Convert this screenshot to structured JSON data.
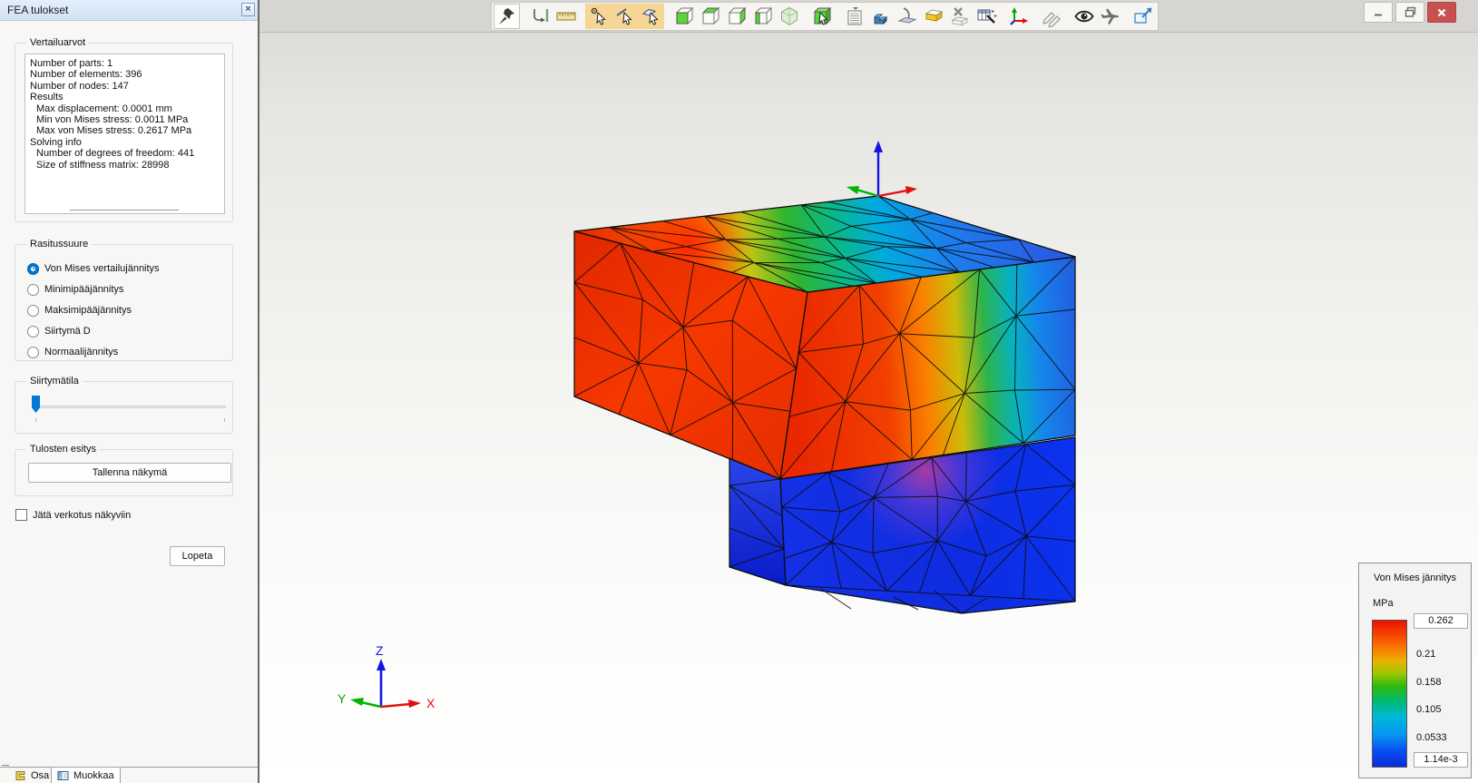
{
  "panel": {
    "title": "FEA tulokset",
    "results_group": {
      "label": "Vertailuarvot",
      "lines": [
        {
          "text": "Number of parts: 1",
          "indent": 0
        },
        {
          "text": "Number of elements: 396",
          "indent": 0
        },
        {
          "text": "Number of nodes: 147",
          "indent": 0
        },
        {
          "text": "Results",
          "indent": 0
        },
        {
          "text": "Max displacement: 0.0001 mm",
          "indent": 1
        },
        {
          "text": "Min von Mises stress: 0.0011 MPa",
          "indent": 1
        },
        {
          "text": "Max von Mises stress: 0.2617 MPa",
          "indent": 1
        },
        {
          "text": "Solving info",
          "indent": 0
        },
        {
          "text": "Number of degrees of freedom: 441",
          "indent": 1
        },
        {
          "text": "Size of stiffness matrix: 28998",
          "indent": 1
        }
      ]
    },
    "stress_group": {
      "label": "Rasitussuure",
      "options": [
        {
          "label": "Von Mises vertailujännitys",
          "selected": true
        },
        {
          "label": "Minimipääjännitys",
          "selected": false
        },
        {
          "label": "Maksimipääjännitys",
          "selected": false
        },
        {
          "label": "Siirtymä D",
          "selected": false
        },
        {
          "label": "Normaalijännitys",
          "selected": false
        }
      ]
    },
    "displacement_group": {
      "label": "Siirtymätila",
      "slider_position_pct": 0
    },
    "output_group": {
      "label": "Tulosten esitys",
      "save_view_button": "Tallenna näkymä"
    },
    "mesh_checkbox": {
      "label": "Jätä verkotus näkyviin",
      "checked": false
    },
    "quit_button": "Lopeta",
    "tabs": [
      {
        "label": "Osa",
        "icon": "part-icon",
        "active": false
      },
      {
        "label": "Muokkaa",
        "icon": "edit-icon",
        "active": true
      }
    ]
  },
  "toolbar": {
    "buttons": [
      {
        "name": "pin",
        "style": "boxed"
      },
      {
        "name": "measure-distance"
      },
      {
        "name": "ruler"
      },
      {
        "name": "select-vertex",
        "highlighted": true
      },
      {
        "name": "select-edge",
        "highlighted": true
      },
      {
        "name": "select-face",
        "highlighted": true
      },
      {
        "name": "view-front"
      },
      {
        "name": "view-top"
      },
      {
        "name": "view-right"
      },
      {
        "name": "view-left"
      },
      {
        "name": "view-isometric"
      },
      {
        "name": "select-body"
      },
      {
        "name": "feature-list"
      },
      {
        "name": "extrude-block"
      },
      {
        "name": "sheet-plane"
      },
      {
        "name": "section-box"
      },
      {
        "name": "delete-face"
      },
      {
        "name": "table-edit"
      },
      {
        "name": "coordinate-system"
      },
      {
        "name": "sketch-pencils"
      },
      {
        "name": "visibility-eye"
      },
      {
        "name": "fly-through"
      },
      {
        "name": "export-view"
      }
    ]
  },
  "window_controls": [
    {
      "name": "minimize"
    },
    {
      "name": "restore"
    },
    {
      "name": "close"
    }
  ],
  "viewport": {
    "triad_labels": {
      "x": "X",
      "y": "Y",
      "z": "Z"
    },
    "axis_colors": {
      "x": "#e01010",
      "y": "#00a800",
      "z": "#1515e0"
    }
  },
  "legend": {
    "title": "Von Mises jännitys",
    "unit": "MPa",
    "max_value": "0.262",
    "ticks": [
      "0.21",
      "0.158",
      "0.105",
      "0.0533"
    ],
    "min_value": "1.14e-3",
    "color_top": "#ec1000",
    "color_bottom": "#0b2bd8"
  }
}
